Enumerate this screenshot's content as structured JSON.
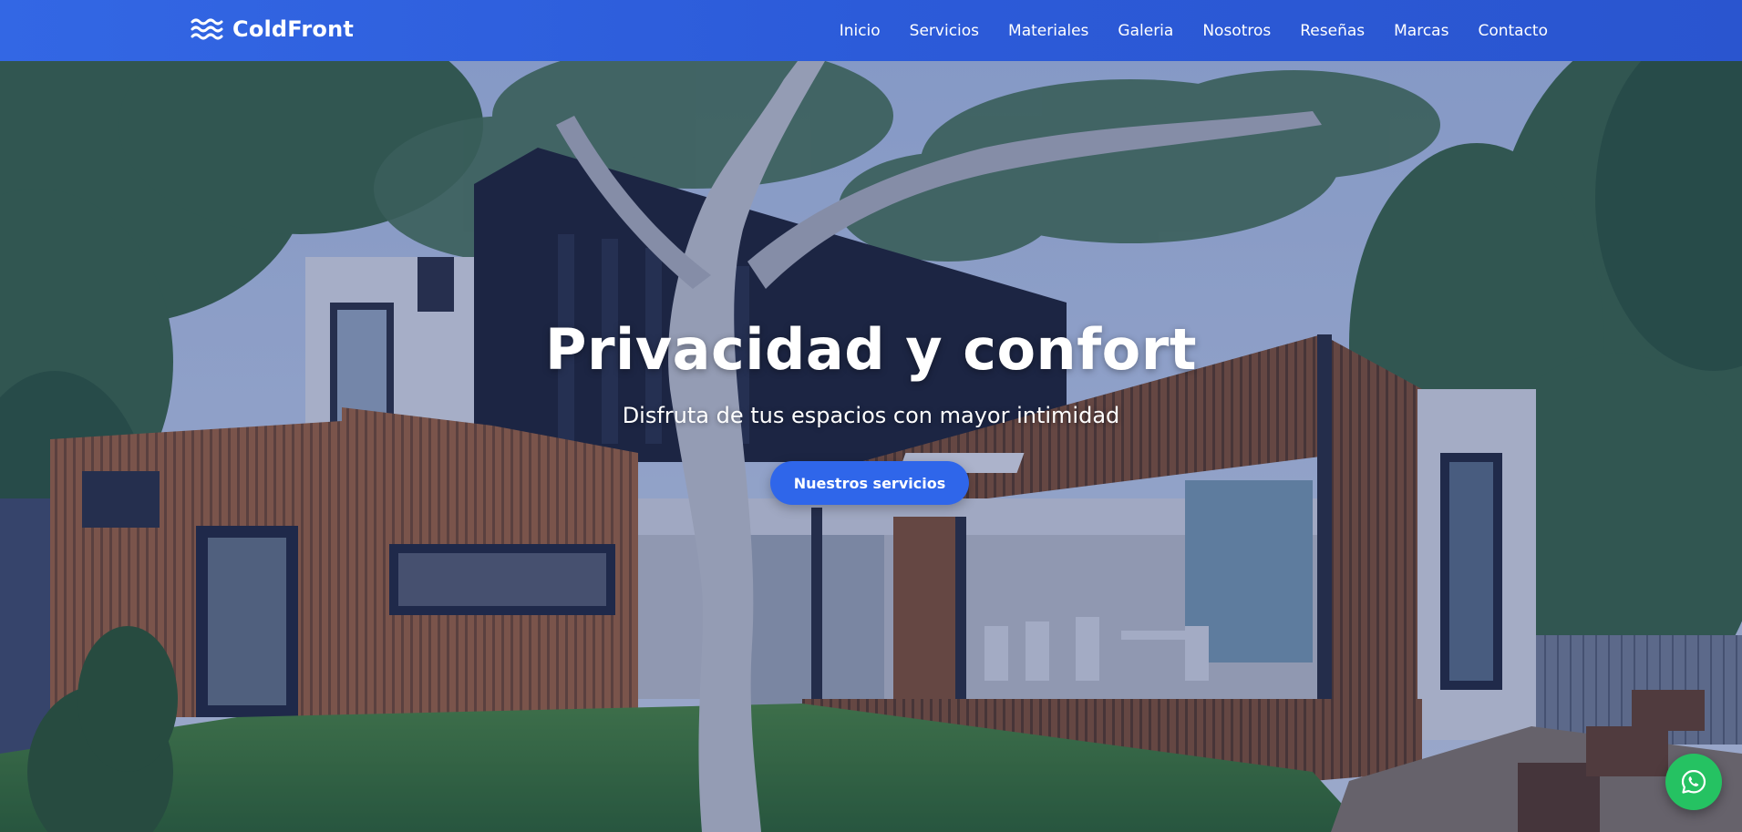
{
  "header": {
    "brand_name": "ColdFront",
    "brand_icon": "waves-icon",
    "nav": [
      {
        "label": "Inicio"
      },
      {
        "label": "Servicios"
      },
      {
        "label": "Materiales"
      },
      {
        "label": "Galeria"
      },
      {
        "label": "Nosotros"
      },
      {
        "label": "Reseñas"
      },
      {
        "label": "Marcas"
      },
      {
        "label": "Contacto"
      }
    ]
  },
  "hero": {
    "title": "Privacidad y confort",
    "subtitle": "Disfruta de tus espacios con mayor intimidad",
    "cta_label": "Nuestros servicios"
  },
  "floating": {
    "whatsapp_icon": "whatsapp-icon"
  },
  "colors": {
    "header_bg": "#2c5bd9",
    "cta_bg": "#2f66ea",
    "whatsapp_bg": "#25c262"
  }
}
